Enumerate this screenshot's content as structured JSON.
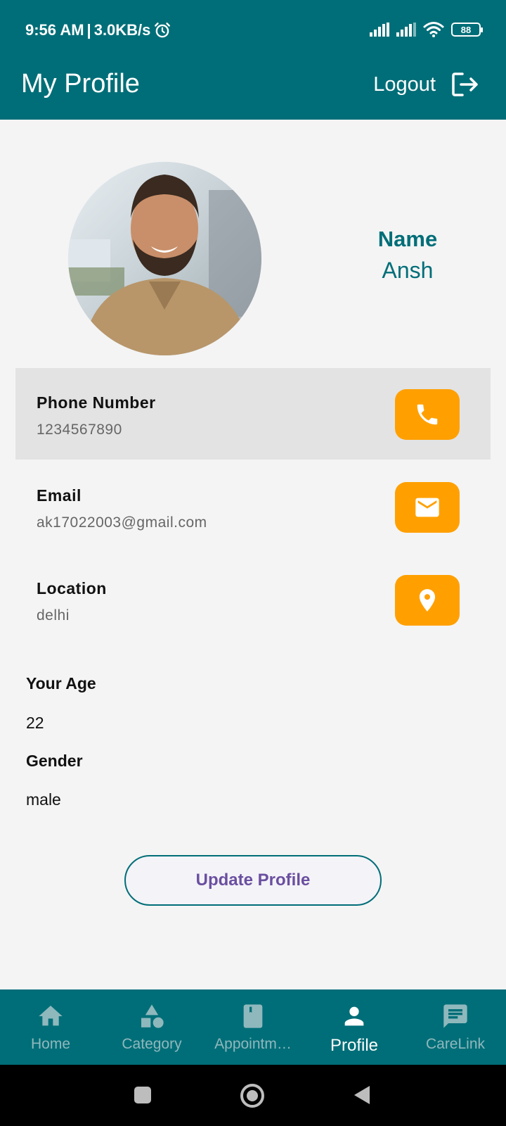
{
  "status_bar": {
    "time": "9:56 AM",
    "separator": "|",
    "speed": "3.0KB/s",
    "battery": "88"
  },
  "app_bar": {
    "title": "My Profile",
    "logout_label": "Logout"
  },
  "profile": {
    "name_label": "Name",
    "name_value": "Ansh"
  },
  "contacts": [
    {
      "label": "Phone Number",
      "value": "1234567890",
      "icon": "phone-icon"
    },
    {
      "label": "Email",
      "value": "ak17022003@gmail.com",
      "icon": "mail-icon"
    },
    {
      "label": "Location",
      "value": "delhi",
      "icon": "location-pin-icon"
    }
  ],
  "details": {
    "age_label": "Your Age",
    "age_value": "22",
    "gender_label": "Gender",
    "gender_value": "male"
  },
  "update_button": "Update Profile",
  "bottom_nav": [
    {
      "label": "Home",
      "icon": "home-icon",
      "active": false
    },
    {
      "label": "Category",
      "icon": "category-icon",
      "active": false
    },
    {
      "label": "Appointm…",
      "icon": "book-icon",
      "active": false
    },
    {
      "label": "Profile",
      "icon": "person-icon",
      "active": true
    },
    {
      "label": "CareLink",
      "icon": "chat-icon",
      "active": false
    }
  ],
  "colors": {
    "primary": "#006e78",
    "accent": "#ffa000",
    "button_text": "#6a4fa0",
    "background": "#f4f4f4"
  }
}
